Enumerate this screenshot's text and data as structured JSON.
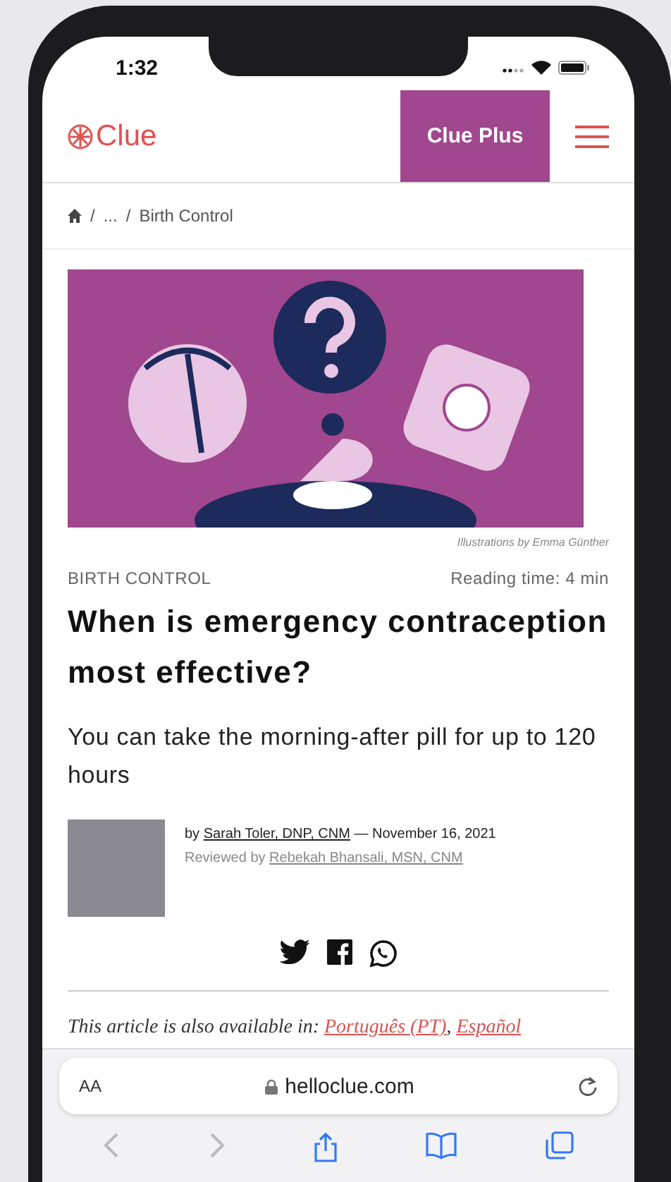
{
  "status_bar": {
    "time": "1:32"
  },
  "header": {
    "logo": "Clue",
    "plus_button": "Clue Plus"
  },
  "breadcrumb": {
    "separator": "/",
    "items": [
      "...",
      "Birth Control"
    ]
  },
  "article": {
    "caption": "Illustrations by Emma Günther",
    "category": "BIRTH CONTROL",
    "reading_time": "Reading time: 4 min",
    "title": "When is emergency contraception most effective?",
    "subtitle": "You can take the morning-after pill for up to 120 hours",
    "byline": {
      "prefix": "by",
      "author": "Sarah Toler, DNP, CNM",
      "date": "— November 16, 2021"
    },
    "review": {
      "prefix": "Reviewed by",
      "reviewer": "Rebekah Bhansali, MSN, CNM"
    },
    "languages": {
      "intro": "This article is also available in:",
      "separator": ",",
      "links": [
        "Português (PT)",
        "Español"
      ]
    }
  },
  "browser": {
    "text_size_button": "AA",
    "url": "helloclue.com"
  }
}
